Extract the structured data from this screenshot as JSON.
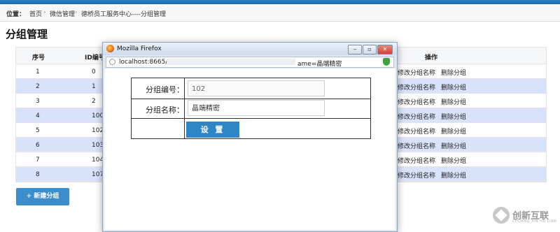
{
  "breadcrumb": {
    "label": "位置：",
    "items": [
      "首页",
      "微信管理",
      "德桥员工服务中心----分组管理"
    ],
    "separator": "›"
  },
  "page": {
    "title": "分组管理"
  },
  "table": {
    "headers": [
      "序号",
      "ID编号",
      "操作"
    ],
    "rows": [
      {
        "no": "1",
        "id": "0"
      },
      {
        "no": "2",
        "id": "1"
      },
      {
        "no": "3",
        "id": "2"
      },
      {
        "no": "4",
        "id": "100"
      },
      {
        "no": "5",
        "id": "102"
      },
      {
        "no": "6",
        "id": "103"
      },
      {
        "no": "7",
        "id": "104"
      },
      {
        "no": "8",
        "id": "107"
      }
    ],
    "action_edit": "修改分组名称",
    "action_delete": "删除分组",
    "alt_row_color": "#d9e2fb"
  },
  "add_button": {
    "label": "+ 新建分组"
  },
  "dialog": {
    "title": "Mozilla Firefox",
    "url_left": "localhost:8665/",
    "url_right": "ame=晶端精密",
    "win_buttons": [
      "‒",
      "▫",
      "✕"
    ],
    "form": {
      "id_label": "分组编号：",
      "id_value": "102",
      "name_label": "分组名称：",
      "name_value": "晶端精密",
      "submit_label": "设 置"
    }
  },
  "watermark": {
    "text": "创新互联",
    "sub": "CHUANG XIN HU LIAN"
  },
  "colors": {
    "accent": "#2f86c6",
    "topbar": "#1d6aa8"
  }
}
